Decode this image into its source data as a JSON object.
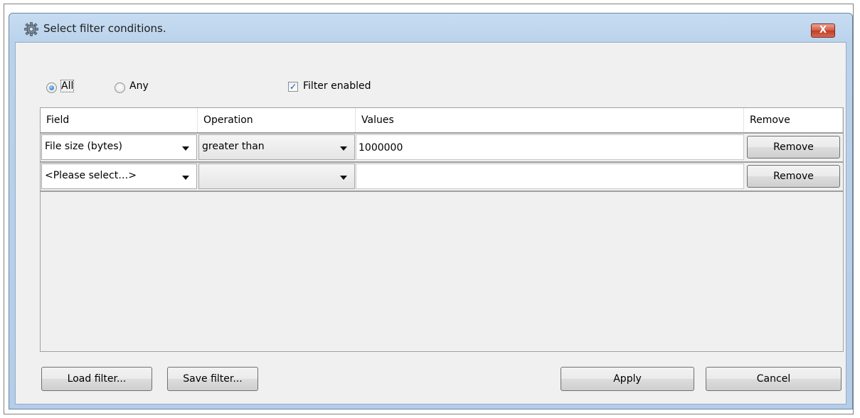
{
  "dialog": {
    "title": "Select filter conditions.",
    "close_label": "X"
  },
  "options": {
    "all_label": "All",
    "any_label": "Any",
    "all_selected": true,
    "filter_enabled_label": "Filter enabled",
    "filter_enabled_checked": true,
    "check_glyph": "✓"
  },
  "grid": {
    "columns": [
      "Field",
      "Operation",
      "Values",
      "Remove"
    ],
    "rows": [
      {
        "field": "File size (bytes)",
        "operation": "greater than",
        "value": "1000000",
        "remove_label": "Remove"
      },
      {
        "field": "<Please select…>",
        "operation": "",
        "value": "",
        "remove_label": "Remove"
      }
    ]
  },
  "buttons": {
    "load": "Load filter...",
    "save": "Save filter...",
    "apply": "Apply",
    "cancel": "Cancel"
  },
  "colors": {
    "titlebar": "#bad3ec",
    "client": "#f0f0f0",
    "close": "#c03b25",
    "checkmark": "#2c4d8c"
  },
  "icons": {
    "title": "gear-icon",
    "close": "close-icon",
    "dropdown": "chevron-down-icon"
  }
}
